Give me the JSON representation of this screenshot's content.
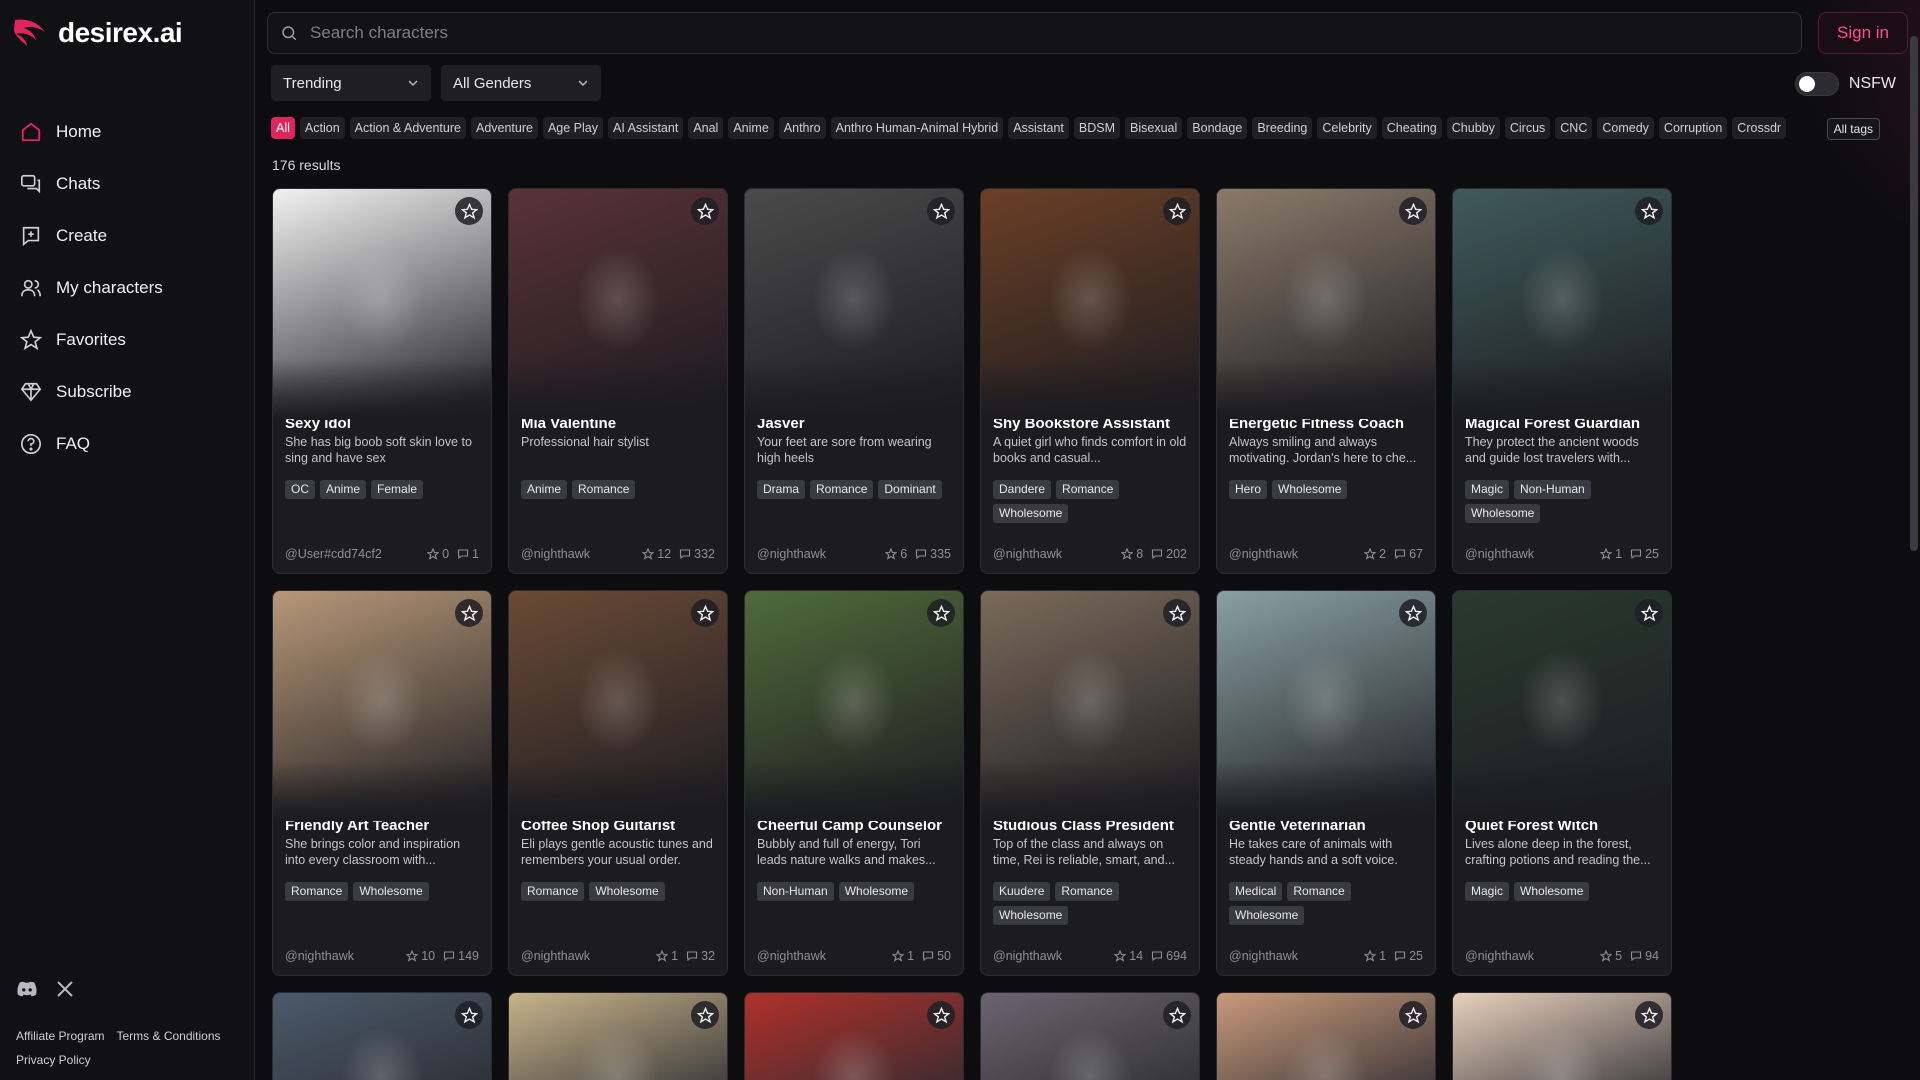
{
  "brand": {
    "name": "desirex.ai",
    "color": "#e0245e"
  },
  "search": {
    "placeholder": "Search characters"
  },
  "auth": {
    "signin_label": "Sign in"
  },
  "sidebar": {
    "items": [
      {
        "label": "Home",
        "icon": "home-icon"
      },
      {
        "label": "Chats",
        "icon": "chats-icon"
      },
      {
        "label": "Create",
        "icon": "create-icon"
      },
      {
        "label": "My characters",
        "icon": "users-icon"
      },
      {
        "label": "Favorites",
        "icon": "star-icon"
      },
      {
        "label": "Subscribe",
        "icon": "diamond-icon"
      },
      {
        "label": "FAQ",
        "icon": "help-icon"
      }
    ],
    "social": [
      "discord-icon",
      "x-icon"
    ],
    "links": [
      "Affiliate Program",
      "Terms & Conditions",
      "Privacy Policy"
    ]
  },
  "filters": {
    "sort": "Trending",
    "gender": "All Genders",
    "nsfw_label": "NSFW",
    "nsfw_on": false
  },
  "tags": [
    "All",
    "Action",
    "Action & Adventure",
    "Adventure",
    "Age Play",
    "AI Assistant",
    "Anal",
    "Anime",
    "Anthro",
    "Anthro Human-Animal Hybrid",
    "Assistant",
    "BDSM",
    "Bisexual",
    "Bondage",
    "Breeding",
    "Celebrity",
    "Cheating",
    "Chubby",
    "Circus",
    "CNC",
    "Comedy",
    "Corruption",
    "Crossdr"
  ],
  "all_tags_label": "All tags",
  "results_label": "176 results",
  "cards": [
    {
      "name": "Sexy idol",
      "desc": "She has big boob soft skin love to sing and have sex",
      "tags": [
        "OC",
        "Anime",
        "Female"
      ],
      "author": "@User#cdd74cf2",
      "stars": "0",
      "chats": "1",
      "bg": "#f2f2f2"
    },
    {
      "name": "Mia Valentine",
      "desc": "Professional hair stylist",
      "tags": [
        "Anime",
        "Romance"
      ],
      "author": "@nighthawk",
      "stars": "12",
      "chats": "332",
      "bg": "#5a3236"
    },
    {
      "name": "Jasver",
      "desc": "Your feet are sore from wearing high heels",
      "tags": [
        "Drama",
        "Romance",
        "Dominant"
      ],
      "author": "@nighthawk",
      "stars": "6",
      "chats": "335",
      "bg": "#4a4a4a"
    },
    {
      "name": "Shy Bookstore Assistant",
      "desc": "A quiet girl who finds comfort in old books and casual...",
      "tags": [
        "Dandere",
        "Romance",
        "Wholesome"
      ],
      "author": "@nighthawk",
      "stars": "8",
      "chats": "202",
      "bg": "#6b3f25"
    },
    {
      "name": "Energetic Fitness Coach",
      "desc": "Always smiling and always motivating. Jordan's here to che...",
      "tags": [
        "Hero",
        "Wholesome"
      ],
      "author": "@nighthawk",
      "stars": "2",
      "chats": "67",
      "bg": "#8a7a6a"
    },
    {
      "name": "Magical Forest Guardian",
      "desc": "They protect the ancient woods and guide lost travelers with...",
      "tags": [
        "Magic",
        "Non-Human",
        "Wholesome"
      ],
      "author": "@nighthawk",
      "stars": "1",
      "chats": "25",
      "bg": "#3f5a5c"
    },
    {
      "name": "Friendly Art Teacher",
      "desc": "She brings color and inspiration into every classroom with...",
      "tags": [
        "Romance",
        "Wholesome"
      ],
      "author": "@nighthawk",
      "stars": "10",
      "chats": "149",
      "bg": "#b89878"
    },
    {
      "name": "Coffee Shop Guitarist",
      "desc": "Eli plays gentle acoustic tunes and remembers your usual order.",
      "tags": [
        "Romance",
        "Wholesome"
      ],
      "author": "@nighthawk",
      "stars": "1",
      "chats": "32",
      "bg": "#6a4a35"
    },
    {
      "name": "Cheerful Camp Counselor",
      "desc": "Bubbly and full of energy, Tori leads nature walks and makes...",
      "tags": [
        "Non-Human",
        "Wholesome"
      ],
      "author": "@nighthawk",
      "stars": "1",
      "chats": "50",
      "bg": "#4f6a3a"
    },
    {
      "name": "Studious Class President",
      "desc": "Top of the class and always on time, Rei is reliable, smart, and...",
      "tags": [
        "Kuudere",
        "Romance",
        "Wholesome"
      ],
      "author": "@nighthawk",
      "stars": "14",
      "chats": "694",
      "bg": "#7a6a5a"
    },
    {
      "name": "Gentle Veterinarian",
      "desc": "He takes care of animals with steady hands and a soft voice.",
      "tags": [
        "Medical",
        "Romance",
        "Wholesome"
      ],
      "author": "@nighthawk",
      "stars": "1",
      "chats": "25",
      "bg": "#8aa0a4"
    },
    {
      "name": "Quiet Forest Witch",
      "desc": "Lives alone deep in the forest, crafting potions and reading the...",
      "tags": [
        "Magic",
        "Wholesome"
      ],
      "author": "@nighthawk",
      "stars": "5",
      "chats": "94",
      "bg": "#2a3a30"
    }
  ],
  "partial_cards": [
    {
      "bg": "#4a5a6a"
    },
    {
      "bg": "#c8b48a"
    },
    {
      "bg": "#b0302a"
    },
    {
      "bg": "#6a6470"
    },
    {
      "bg": "#c99a7a"
    },
    {
      "bg": "#e8d0bc"
    }
  ]
}
